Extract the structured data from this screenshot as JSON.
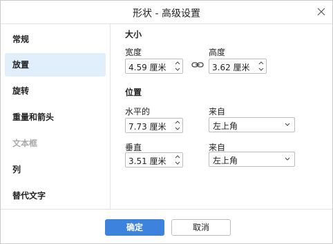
{
  "dialog": {
    "title": "形状 - 高级设置"
  },
  "sidebar": {
    "items": [
      {
        "label": "常规"
      },
      {
        "label": "放置"
      },
      {
        "label": "旋转"
      },
      {
        "label": "重量和箭头"
      },
      {
        "label": "文本框"
      },
      {
        "label": "列"
      },
      {
        "label": "替代文字"
      }
    ],
    "active_index": 1
  },
  "size": {
    "title": "大小",
    "width_label": "宽度",
    "width_value": "4.59 厘米",
    "height_label": "高度",
    "height_value": "3.62 厘米"
  },
  "position": {
    "title": "位置",
    "horizontal_label": "水平的",
    "horizontal_value": "7.73 厘米",
    "horizontal_from_label": "来自",
    "horizontal_from_value": "左上角",
    "vertical_label": "垂直",
    "vertical_value": "3.51 厘米",
    "vertical_from_label": "来自",
    "vertical_from_value": "左上角"
  },
  "footer": {
    "ok_label": "确定",
    "cancel_label": "取消"
  },
  "colors": {
    "primary": "#3d82dd",
    "active_bg": "#e1eefb",
    "disabled_text": "#a9a9a9"
  }
}
